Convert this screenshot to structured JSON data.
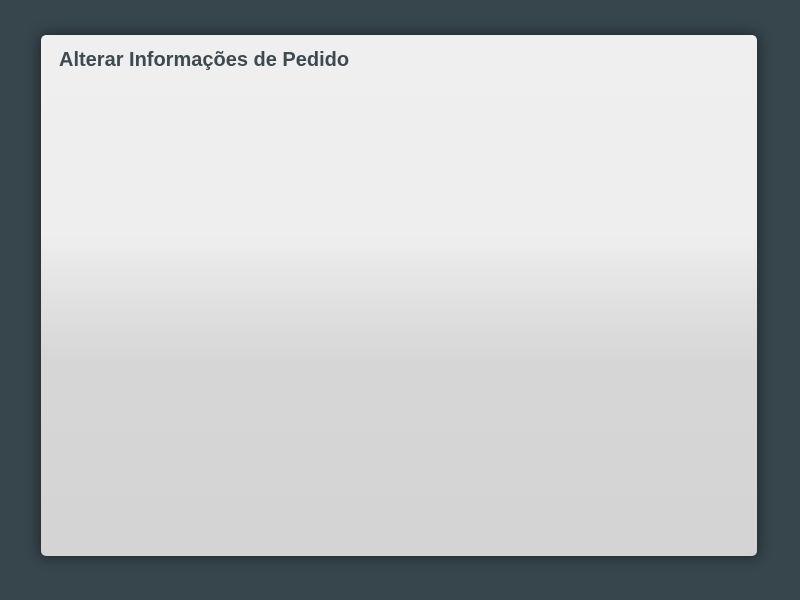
{
  "dialog": {
    "title": "Alterar Informações de Pedido"
  },
  "colors": {
    "backdrop": "#37454d",
    "title_text": "#3d4a50",
    "dialog_top": "#efefef",
    "dialog_bottom": "#d4d4d4"
  }
}
